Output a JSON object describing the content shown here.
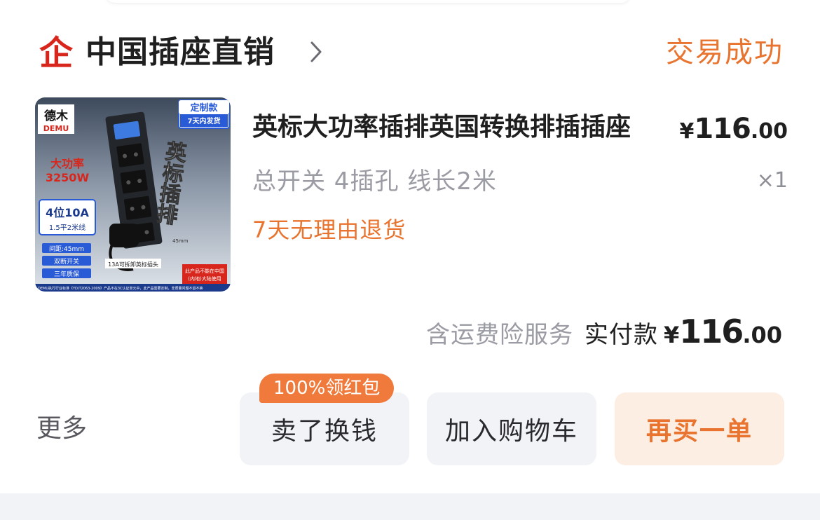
{
  "shop": {
    "name": "中国插座直销",
    "logo_glyph": "企",
    "status": "交易成功"
  },
  "product": {
    "title": "英标大功率插排英国转换排插插座",
    "price": {
      "currency": "¥",
      "integer": "116",
      "decimal": ".00"
    },
    "spec": "总开关 4插孔 线长2米",
    "quantity": "×1",
    "service": "7天无理由退货",
    "image": {
      "brand_cn": "德木",
      "brand_en": "DEMU",
      "custom_tag": "定制款",
      "ship_tag": "7天内发货",
      "power_label": "大功率",
      "power_value": "3250W",
      "spec_main": "4位10A",
      "spec_sub": "1.5平2米线",
      "feature_1": "间距:45mm",
      "feature_2": "双断开关",
      "feature_3": "三年质保",
      "vertical_title": "英标插排",
      "plug_note": "13A可拆卸英标插头",
      "region_note_1": "此产品不能在中国",
      "region_note_2": "(内地)大陆使用",
      "spacing_label": "45mm",
      "footer_note": "DEMU执行行业标准《YD/T2063-2009》产品不在3C认证单元中，此产品需要定制，非质量问题不退不换"
    }
  },
  "payment": {
    "note": "含运费险服务",
    "label": "实付款",
    "currency": "¥",
    "integer": "116",
    "decimal": ".00"
  },
  "actions": {
    "more": "更多",
    "sell": "卖了换钱",
    "sell_badge": "100%领红包",
    "cart": "加入购物车",
    "rebuy": "再买一单"
  },
  "colors": {
    "accent": "#e8742f",
    "badge": "#f07a3c",
    "logo_red": "#d9261c"
  }
}
